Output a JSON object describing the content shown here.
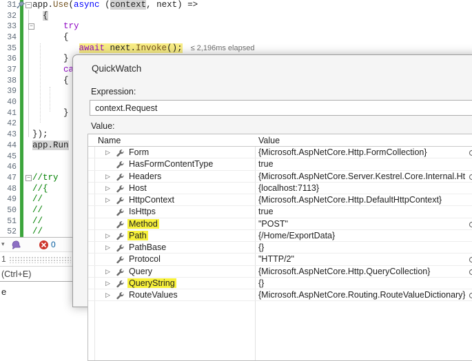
{
  "editor": {
    "code_lines": [
      {
        "num": 31,
        "pin": true,
        "fold": "minus",
        "foldX": 37,
        "segments": [
          {
            "t": "app."
          },
          {
            "t": "Use",
            "s": "m"
          },
          {
            "t": "("
          },
          {
            "t": "async",
            "s": "k"
          },
          {
            "t": " ("
          },
          {
            "t": "context",
            "s": "sym"
          },
          {
            "t": ", next) =>"
          }
        ]
      },
      {
        "num": 32,
        "segments": [
          {
            "t": "  "
          },
          {
            "t": "{",
            "s": "sym"
          }
        ]
      },
      {
        "num": 33,
        "fold": "minus",
        "foldX": 41,
        "segments": [
          {
            "t": "      "
          },
          {
            "t": "try",
            "s": "c"
          }
        ]
      },
      {
        "num": 34,
        "segments": [
          {
            "t": "      {"
          }
        ]
      },
      {
        "num": 35,
        "perf_tip": "≤ 2,196ms elapsed",
        "segments": [
          {
            "t": "         "
          },
          {
            "t": "await",
            "s": "c cur"
          },
          {
            "t": " next.",
            "s": "cur"
          },
          {
            "t": "Invoke",
            "s": "m cur"
          },
          {
            "t": "();",
            "s": "cur"
          }
        ]
      },
      {
        "num": 36,
        "segments": [
          {
            "t": "      }"
          }
        ]
      },
      {
        "num": 37,
        "segments": [
          {
            "t": "      "
          },
          {
            "t": "catch",
            "s": "c"
          }
        ]
      },
      {
        "num": 38,
        "segments": [
          {
            "t": "      {"
          }
        ]
      },
      {
        "num": 39,
        "segments": []
      },
      {
        "num": 40,
        "segments": []
      },
      {
        "num": 41,
        "segments": [
          {
            "t": "      }"
          }
        ]
      },
      {
        "num": 42,
        "segments": []
      },
      {
        "num": 43,
        "segments": [
          {
            "t": "});"
          }
        ]
      },
      {
        "num": 44,
        "segments": [
          {
            "t": "app.Run",
            "s": "sym"
          }
        ]
      },
      {
        "num": 45,
        "segments": []
      },
      {
        "num": 46,
        "segments": []
      },
      {
        "num": 47,
        "fold": "minus",
        "foldX": 37,
        "segments": [
          {
            "t": "//try",
            "s": "cm"
          }
        ]
      },
      {
        "num": 48,
        "segments": [
          {
            "t": "//{",
            "s": "cm"
          }
        ]
      },
      {
        "num": 49,
        "segments": [
          {
            "t": "//",
            "s": "cm"
          }
        ]
      },
      {
        "num": 50,
        "segments": [
          {
            "t": "//",
            "s": "cm"
          }
        ]
      },
      {
        "num": 51,
        "segments": [
          {
            "t": "//",
            "s": "cm"
          }
        ]
      },
      {
        "num": 52,
        "segments": [
          {
            "t": "//",
            "s": "cm"
          }
        ]
      }
    ],
    "status": {
      "dropdown_glyph": "▾",
      "error_count": "0",
      "grip_tab_number": "1",
      "search_hint": "(Ctrl+E)",
      "partial_text": "e"
    }
  },
  "dialog": {
    "title": "QuickWatch",
    "expression_label": "Expression:",
    "expression_value": "context.Request",
    "value_label": "Value:",
    "table": {
      "columns": [
        "Name",
        "Value"
      ],
      "rows": [
        {
          "name": "Form",
          "value": "{Microsoft.AspNetCore.Http.FormCollection}",
          "expandable": true,
          "highlighted": false,
          "magnifier": true
        },
        {
          "name": "HasFormContentType",
          "value": "true",
          "expandable": false,
          "highlighted": false,
          "magnifier": false
        },
        {
          "name": "Headers",
          "value": "{Microsoft.AspNetCore.Server.Kestrel.Core.Internal.Htt...",
          "expandable": true,
          "highlighted": false,
          "magnifier": true
        },
        {
          "name": "Host",
          "value": "{localhost:7113}",
          "expandable": true,
          "highlighted": false,
          "magnifier": false
        },
        {
          "name": "HttpContext",
          "value": "{Microsoft.AspNetCore.Http.DefaultHttpContext}",
          "expandable": true,
          "highlighted": false,
          "magnifier": false
        },
        {
          "name": "IsHttps",
          "value": "true",
          "expandable": false,
          "highlighted": false,
          "magnifier": false
        },
        {
          "name": "Method",
          "value": "\"POST\"",
          "expandable": false,
          "highlighted": true,
          "magnifier": true
        },
        {
          "name": "Path",
          "value": "{/Home/ExportData}",
          "expandable": true,
          "highlighted": true,
          "magnifier": false
        },
        {
          "name": "PathBase",
          "value": "{}",
          "expandable": true,
          "highlighted": false,
          "magnifier": false
        },
        {
          "name": "Protocol",
          "value": "\"HTTP/2\"",
          "expandable": false,
          "highlighted": false,
          "magnifier": true
        },
        {
          "name": "Query",
          "value": "{Microsoft.AspNetCore.Http.QueryCollection}",
          "expandable": true,
          "highlighted": false,
          "magnifier": true
        },
        {
          "name": "QueryString",
          "value": "{}",
          "expandable": true,
          "highlighted": true,
          "magnifier": false
        },
        {
          "name": "RouteValues",
          "value": "{Microsoft.AspNetCore.Routing.RouteValueDictionary}",
          "expandable": true,
          "highlighted": false,
          "magnifier": true
        }
      ]
    }
  },
  "colors": {
    "statement_highlight": "#f8ec84",
    "find_highlight": "#f7f13a",
    "symbol_highlight": "#d4d4d4",
    "keyword_blue": "#0000ff",
    "control_purple": "#8f08c4",
    "method_brown": "#74531f",
    "comment_green": "#008000",
    "change_bar_green": "#3ca53c",
    "error_red": "#ce352c"
  }
}
